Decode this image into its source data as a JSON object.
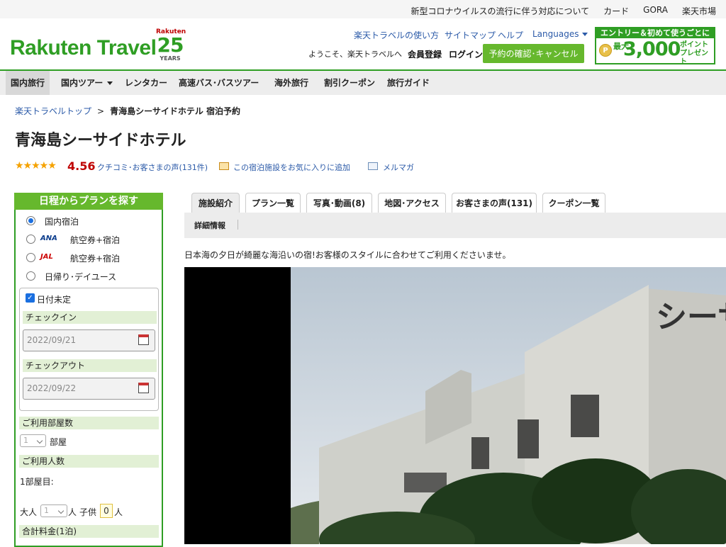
{
  "topbar": {
    "links": [
      "新型コロナウイルスの流行に伴う対応について",
      "カード",
      "GORA",
      "楽天市場"
    ]
  },
  "header": {
    "logo": "Rakuten Travel",
    "anniv_brand": "Rakuten",
    "anniv_number": "25",
    "anniv_years": "YEARS",
    "nav": [
      "楽天トラベルの使い方",
      "サイトマップ",
      "ヘルプ",
      "Languages"
    ],
    "welcome": "ようこそ、楽天トラベルへ",
    "register": "会員登録",
    "login": "ログイン",
    "confirm_button": "予約の確認･キャンセル",
    "promo": {
      "top": "エントリー＆初めて使うごとに",
      "max": "最大",
      "amount": "3,000",
      "points": "ポイント",
      "present": "プレゼント",
      "coin": "P"
    }
  },
  "gnav": [
    "国内旅行",
    "国内ツアー",
    "レンタカー",
    "高速バス･バスツアー",
    "海外旅行",
    "割引クーポン",
    "旅行ガイド"
  ],
  "breadcrumb": {
    "home": "楽天トラベルトップ",
    "sep": ">",
    "current": "青海島シーサイドホテル 宿泊予約"
  },
  "hotel": {
    "name": "青海島シーサイドホテル",
    "stars": "★★★★★",
    "score": "4.56",
    "reviews_link": "クチコミ･お客さまの声(131件)",
    "favorite_link": "この宿泊施設をお気に入りに追加",
    "mailmag_link": "メルマガ"
  },
  "sidebar": {
    "heading": "日程からプランを探す",
    "options": [
      {
        "label": "国内宿泊",
        "brand": "",
        "selected": true
      },
      {
        "label": "航空券+宿泊",
        "brand": "ANA",
        "selected": false
      },
      {
        "label": "航空券+宿泊",
        "brand": "JAL",
        "selected": false
      },
      {
        "label": "日帰り･デイユース",
        "brand": "",
        "selected": false
      }
    ],
    "date_undecided": "日付未定",
    "checkin_label": "チェックイン",
    "checkin_value": "2022/09/21",
    "checkout_label": "チェックアウト",
    "checkout_value": "2022/09/22",
    "rooms_label": "ご利用部屋数",
    "rooms_value": "1",
    "rooms_unit": "部屋",
    "guests_label": "ご利用人数",
    "room1": "1部屋目:",
    "adult_label": "大人",
    "adult_value": "1",
    "person_unit": "人",
    "child_label": "子供",
    "child_value": "0",
    "child_unit": "人",
    "total_label": "合計料金(1泊)"
  },
  "tabs": [
    "施設紹介",
    "プラン一覧",
    "写真･動画(8)",
    "地図･アクセス",
    "お客さまの声(131)",
    "クーポン一覧"
  ],
  "subtab": "詳細情報",
  "description": "日本海の夕日が綺麗な海沿いの宿!お客様のスタイルに合わせてご利用くださいませ。",
  "photo_sign": "シーサ",
  "colors": {
    "brand_green": "#2f9e24",
    "accent_red": "#bf0000",
    "link_blue": "#2b5aa8"
  }
}
